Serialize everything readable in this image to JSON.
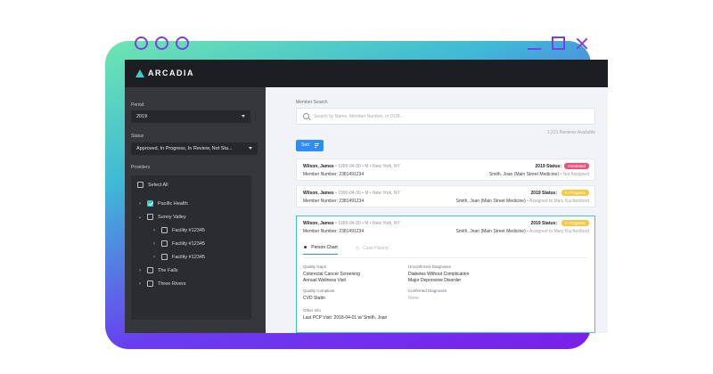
{
  "app": {
    "brand": "ARCADIA"
  },
  "sidebar": {
    "period_label": "Period",
    "period_value": "2019",
    "status_label": "Status",
    "status_value": "Approved, In Progress, In Review, Not Sta...",
    "providers_label": "Providers",
    "providers": [
      {
        "label": "Select All",
        "checked": false
      },
      {
        "label": "Pacific Health",
        "checked": true
      },
      {
        "label": "Sunny Valley",
        "checked": false
      },
      {
        "label": "Facility #12345",
        "checked": false
      },
      {
        "label": "Facility #12345",
        "checked": false
      },
      {
        "label": "Facility #12345",
        "checked": false
      },
      {
        "label": "The Falls",
        "checked": false
      },
      {
        "label": "Three Rivers",
        "checked": false
      }
    ]
  },
  "main": {
    "search_label": "Member Search",
    "search_placeholder": "Search by Name, Member Number, or DOB...",
    "reviews_count": "1,221 Reviews Available",
    "sort_label": "Sort",
    "rows": [
      {
        "name": "Wilson, James",
        "meta": "• 1990-04-30 • M • New York, NY",
        "member": "Member Number: 2381491234",
        "status_label": "2019 Status:",
        "badge": "Escalated",
        "badge_color": "#f0507a",
        "provider": "Smith, Joan (Main Street Medicine)",
        "assigned": "• Not Assigned"
      },
      {
        "name": "Wilson, James",
        "meta": "• 1990-04-30 • M • New York, NY",
        "member": "Member Number: 2381491234",
        "status_label": "2019 Status:",
        "badge": "In Progress",
        "badge_color": "#f5c84a",
        "provider": "Smith, Joan (Main Street Medicine)",
        "assigned": "• Assigned to Mary Kuchenbrod"
      },
      {
        "name": "Wilson, James",
        "meta": "• 1990-04-30 • M • New York, NY",
        "member": "Member Number: 2381491234",
        "status_label": "2019 Status:",
        "badge": "In Progress",
        "badge_color": "#f5c84a",
        "provider": "Smith, Joan (Main Street Medicine)",
        "assigned": "• Assigned to Mary Kuchenbrod"
      }
    ],
    "detail": {
      "tab_person": "Person Chart",
      "tab_history": "Case History",
      "quality_gaps_head": "Quality Gaps",
      "quality_gaps": [
        "Colorectal Cancer Screening",
        "Annual Wellness Visit"
      ],
      "quality_compliant_head": "Quality Compliant",
      "quality_compliant": "CVD Statin",
      "other_info_head": "Other Info",
      "other_info": "Last PCP Visit: 2018-04-01 w/ Smith, Joan",
      "unconfirmed_head": "Unconfirmed Diagnoses",
      "unconfirmed": [
        "Diabetes Without Complication",
        "Major Depressive Disorder"
      ],
      "confirmed_head": "Confirmed Diagnoses",
      "confirmed": "None"
    }
  },
  "colors": {
    "accent": "#2f8df2",
    "brand_frame": "#7b3fe4",
    "teal": "#34c7c2"
  }
}
